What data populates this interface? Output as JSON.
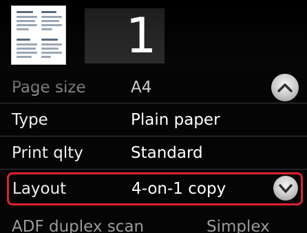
{
  "copies": {
    "value": "1"
  },
  "settings": {
    "page_size": {
      "label": "Page size",
      "value": "A4"
    },
    "type": {
      "label": "Type",
      "value": "Plain paper"
    },
    "print_qlty": {
      "label": "Print qlty",
      "value": "Standard"
    },
    "layout": {
      "label": "Layout",
      "value": "4-on-1 copy"
    },
    "adf_duplex_scan": {
      "label": "ADF duplex scan",
      "value": "Simplex"
    }
  },
  "icons": {
    "scroll_up": "chevron-up-icon",
    "scroll_down": "chevron-down-icon",
    "layout_preview": "4-on-1-layout-preview-icon"
  },
  "colors": {
    "background": "#050505",
    "highlight_border": "#e0212f",
    "text": "#f4f4f4"
  }
}
